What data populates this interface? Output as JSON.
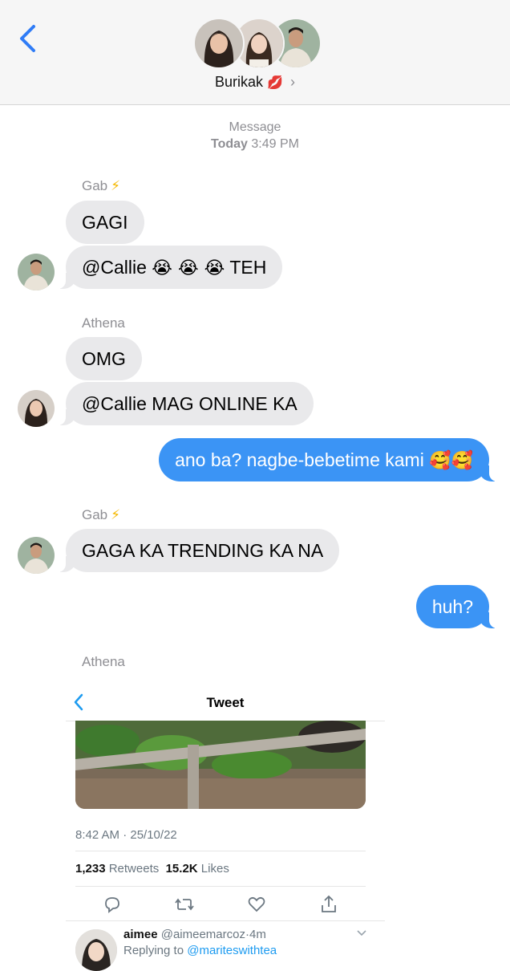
{
  "header": {
    "group_name": "Burikak",
    "name_emoji": "💋",
    "chevron": "›",
    "back_icon": "chevron-left-icon"
  },
  "timestamp": {
    "line1": "Message",
    "day": "Today",
    "time": "3:49 PM"
  },
  "messages": [
    {
      "sender": "Gab",
      "sender_emoji": "⚡",
      "text": "GAGI"
    },
    {
      "text": "@Callie",
      "emojis": "😭 😭 😭",
      "suffix": "TEH"
    },
    {
      "sender": "Athena",
      "text": "OMG"
    },
    {
      "text": "@Callie MAG ONLINE KA"
    },
    {
      "text": "ano ba? nagbe-bebetime kami",
      "emojis": "🥰🥰"
    },
    {
      "sender": "Gab",
      "sender_emoji": "⚡",
      "text": "GAGA KA TRENDING KA NA"
    },
    {
      "text": "huh?"
    },
    {
      "sender": "Athena"
    }
  ],
  "tweet": {
    "title": "Tweet",
    "datetime": "8:42 AM · 25/10/22",
    "retweets": "1,233",
    "retweets_label": "Retweets",
    "likes": "15.2K",
    "likes_label": "Likes",
    "reply": {
      "name": "aimee",
      "handle": "@aimeemarcoz",
      "age": "4m",
      "replying_label": "Replying to",
      "replying_to": "@mariteswithtea"
    }
  },
  "colors": {
    "outgoing_bubble": "#3b94f5",
    "incoming_bubble": "#e9e9eb",
    "accent": "#1d9bf0"
  }
}
